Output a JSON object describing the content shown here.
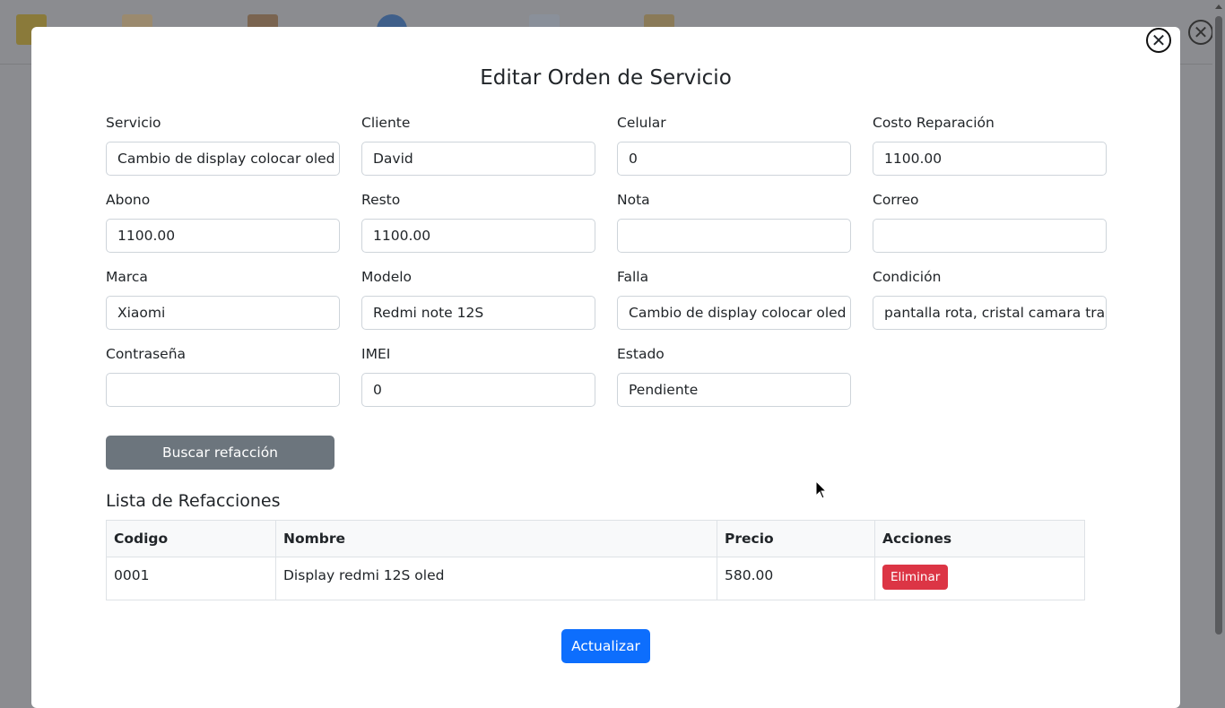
{
  "modal": {
    "title": "Editar Orden de Servicio"
  },
  "fields": [
    {
      "label": "Servicio",
      "value": "Cambio de display colocar oled"
    },
    {
      "label": "Cliente",
      "value": "David"
    },
    {
      "label": "Celular",
      "value": "0"
    },
    {
      "label": "Costo Reparación",
      "value": "1100.00"
    },
    {
      "label": "Abono",
      "value": "1100.00"
    },
    {
      "label": "Resto",
      "value": "1100.00"
    },
    {
      "label": "Nota",
      "value": ""
    },
    {
      "label": "Correo",
      "value": ""
    },
    {
      "label": "Marca",
      "value": "Xiaomi"
    },
    {
      "label": "Modelo",
      "value": "Redmi note 12S"
    },
    {
      "label": "Falla",
      "value": "Cambio de display colocar oled"
    },
    {
      "label": "Condición",
      "value": "pantalla rota, cristal camara trasera"
    },
    {
      "label": "Contraseña",
      "value": ""
    },
    {
      "label": "IMEI",
      "value": "0"
    },
    {
      "label": "Estado",
      "value": "Pendiente"
    }
  ],
  "buscar_label": "Buscar refacción",
  "list_title": "Lista de Refacciones",
  "table": {
    "headers": [
      "Codigo",
      "Nombre",
      "Precio",
      "Acciones"
    ],
    "rows": [
      {
        "codigo": "0001",
        "nombre": "Display redmi 12S oled",
        "precio": "580.00",
        "accion": "Eliminar"
      }
    ]
  },
  "update_label": "Actualizar",
  "close_symbol": "✕"
}
